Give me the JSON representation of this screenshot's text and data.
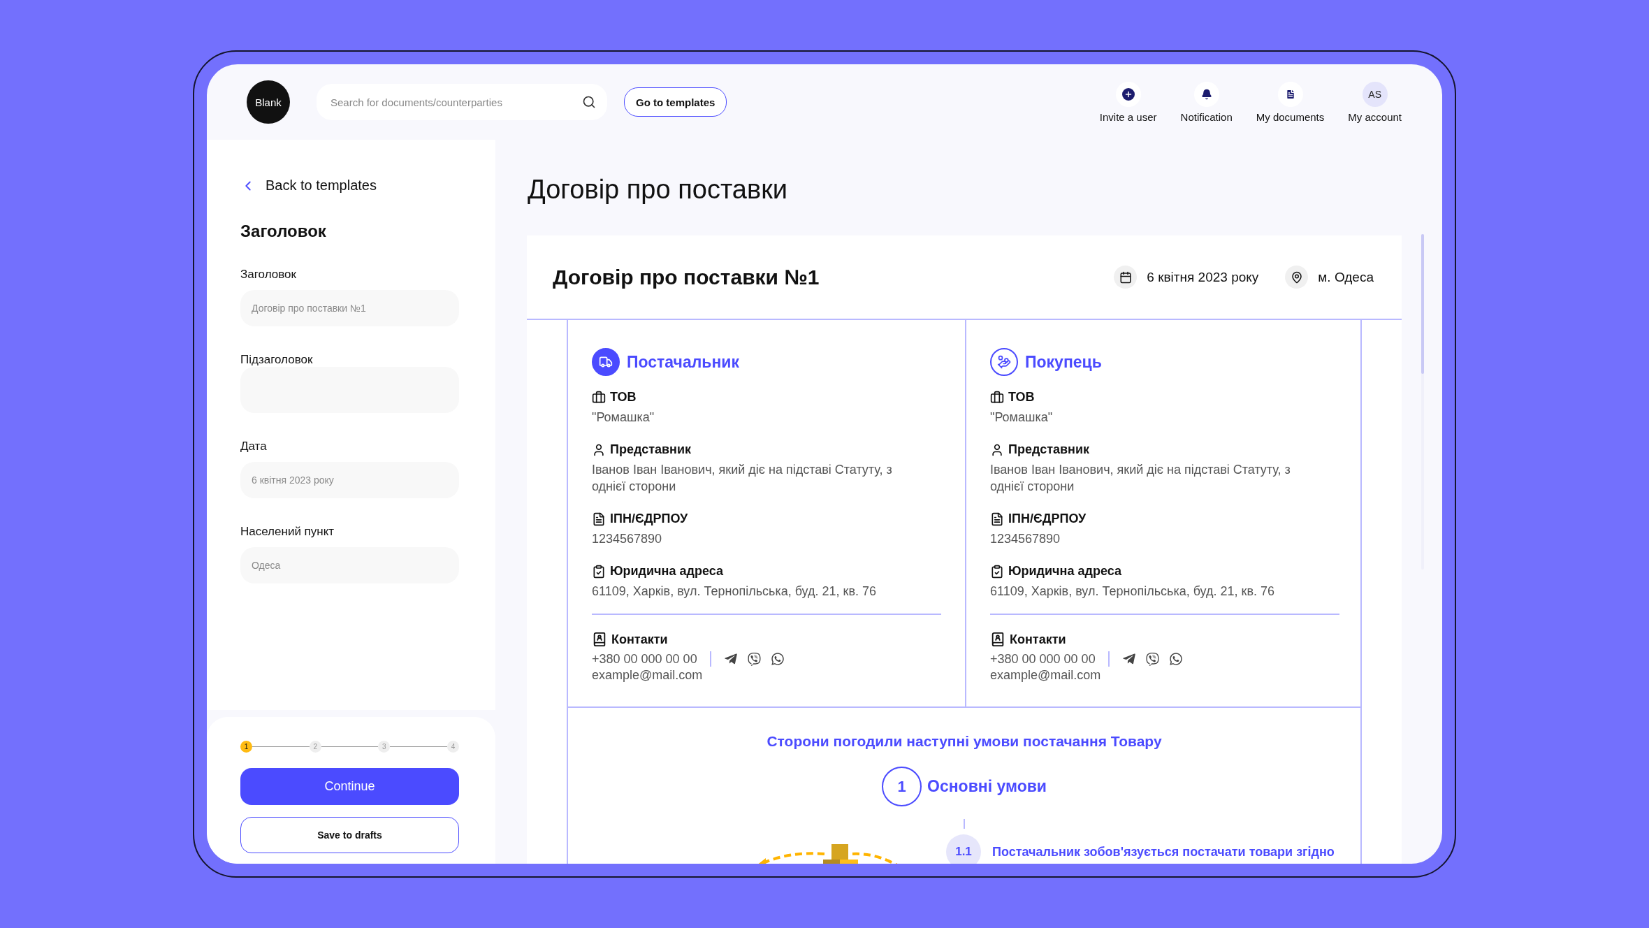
{
  "header": {
    "logo": "Blank",
    "search": {
      "placeholder": "Search for documents/counterparties"
    },
    "templates_button": "Go to templates",
    "nav": [
      {
        "kind": "invite",
        "label": "Invite a user"
      },
      {
        "kind": "notification",
        "label": "Notification"
      },
      {
        "kind": "documents",
        "label": "My documents"
      },
      {
        "kind": "account",
        "label": "My account",
        "initials": "AS"
      }
    ]
  },
  "sidebar": {
    "back_link": "Back to templates",
    "section_title": "Заголовок",
    "fields": [
      {
        "kind": "line",
        "label": "Заголовок",
        "placeholder": "Договір про поставки №1"
      },
      {
        "kind": "area",
        "label": "Підзаголовок"
      },
      {
        "kind": "line",
        "label": "Дата",
        "placeholder": "6 квітня 2023 року"
      },
      {
        "kind": "line",
        "label": "Населений пункт",
        "placeholder": "Одеса"
      }
    ],
    "steps": [
      {
        "label": "1",
        "selected": true
      },
      {
        "label": "2",
        "selected": false
      },
      {
        "label": "3",
        "selected": false
      },
      {
        "label": "4",
        "selected": false
      }
    ],
    "continue_button": "Continue",
    "drafts_button": "Save to drafts"
  },
  "main": {
    "title": "Договір про поставки",
    "document": {
      "title": "Договір про поставки №1",
      "date": "6 квітня 2023 року",
      "place": "м. Одеса",
      "parties": [
        {
          "kind": "supplier",
          "role": "Постачальник",
          "sections": [
            {
              "kind": "company",
              "label": "ТОВ",
              "value": "\"Ромашка\""
            },
            {
              "kind": "representative",
              "label": "Представник",
              "value": "Іванов Іван Іванович, який діє на підставі Статуту, з однієї сторони"
            },
            {
              "kind": "tax_id",
              "label": "ІПН/ЄДРПОУ",
              "value": "1234567890"
            },
            {
              "kind": "address",
              "label": "Юридична адреса",
              "value": "61109, Харків, вул. Тернопільська, буд. 21, кв. 76"
            }
          ],
          "contacts": {
            "label": "Контакти",
            "phone": "+380 00 000 00 00",
            "email": "example@mail.com"
          }
        },
        {
          "kind": "buyer",
          "role": "Покупець",
          "sections": [
            {
              "kind": "company",
              "label": "ТОВ",
              "value": "\"Ромашка\""
            },
            {
              "kind": "representative",
              "label": "Представник",
              "value": "Іванов Іван Іванович, який діє на підставі Статуту, з однієї сторони"
            },
            {
              "kind": "tax_id",
              "label": "ІПН/ЄДРПОУ",
              "value": "1234567890"
            },
            {
              "kind": "address",
              "label": "Юридична адреса",
              "value": "61109, Харків, вул. Тернопільська, буд. 21, кв. 76"
            }
          ],
          "contacts": {
            "label": "Контакти",
            "phone": "+380 00 000 00 00",
            "email": "example@mail.com"
          }
        }
      ],
      "terms_heading": "Сторони погодили наступні умови постачання Товару",
      "section": {
        "number": "1",
        "title": "Основні умови"
      },
      "clause": {
        "number": "1.1",
        "text": "Постачальник зобов'язується постачати товари згідно"
      }
    }
  }
}
